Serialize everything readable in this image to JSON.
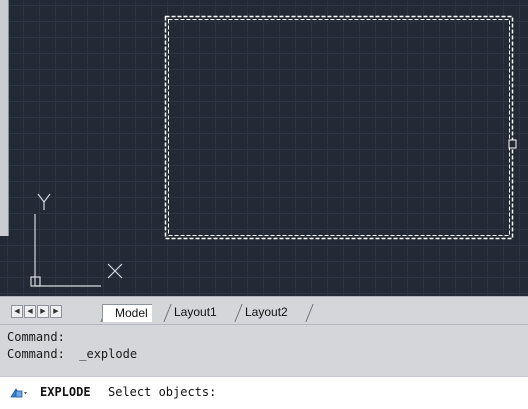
{
  "viewport": {
    "ucs_x_label": "X",
    "ucs_y_label": "Y"
  },
  "tabs": {
    "nav": [
      "first",
      "previous",
      "next",
      "last"
    ],
    "items": [
      "Model",
      "Layout1",
      "Layout2"
    ],
    "active": "Model"
  },
  "history": {
    "lines": [
      "Command:",
      "Command:  _explode"
    ]
  },
  "command": {
    "keyword": "EXPLODE",
    "prompt": "Select objects:",
    "icon": "command-line-icon"
  },
  "colors": {
    "canvas_background": "#232a36",
    "grid_minor": "#2d3442",
    "grid_major": "#3a4252",
    "selection_dash": "#ffffff",
    "ucs_icon": "#d6d9de"
  }
}
